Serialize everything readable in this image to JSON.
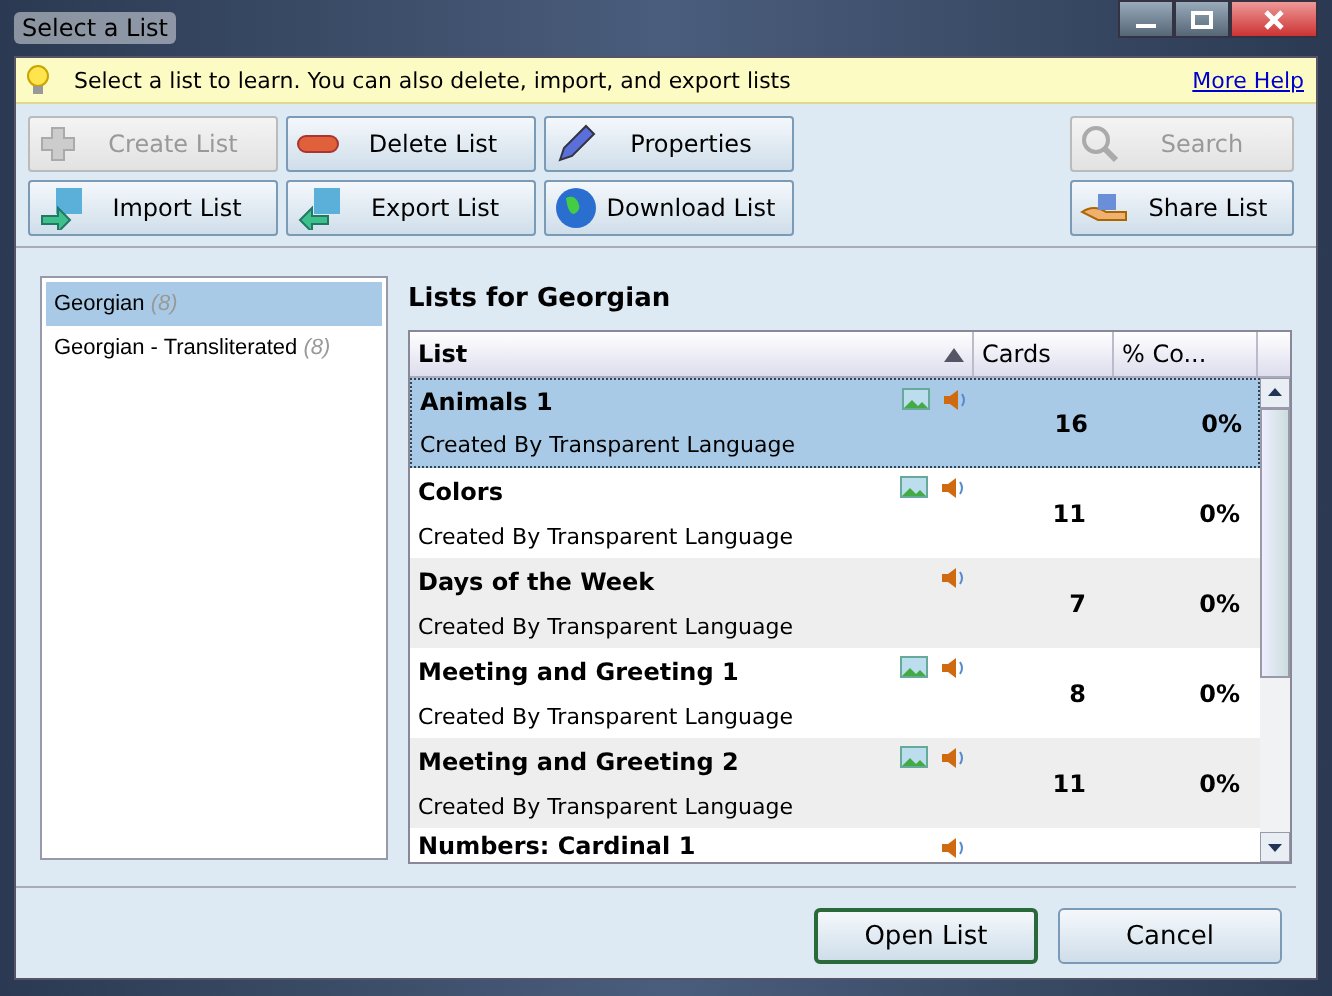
{
  "window": {
    "title": "Select a List"
  },
  "info_bar": {
    "message": "Select a list to learn. You can also delete, import, and export lists",
    "link": "More Help"
  },
  "toolbar": {
    "left": [
      {
        "label": "Create List",
        "kind": "create",
        "disabled": true
      },
      {
        "label": "Delete List",
        "kind": "delete",
        "disabled": false
      },
      {
        "label": "Properties",
        "kind": "edit",
        "disabled": false
      },
      {
        "label": "Import List",
        "kind": "import",
        "disabled": false
      },
      {
        "label": "Export List",
        "kind": "export",
        "disabled": false
      },
      {
        "label": "Download List",
        "kind": "download",
        "disabled": false
      }
    ],
    "right": [
      {
        "label": "Search",
        "kind": "search",
        "disabled": true
      },
      {
        "label": "Share List",
        "kind": "share",
        "disabled": false
      }
    ]
  },
  "languages": [
    {
      "name": "Georgian",
      "count": "(8)",
      "selected": true
    },
    {
      "name": "Georgian - Transliterated",
      "count": "(8)",
      "selected": false
    }
  ],
  "lists_heading": "Lists for Georgian",
  "table": {
    "columns": [
      "List",
      "Cards",
      "% Co..."
    ],
    "sort_ascending": true,
    "rows": [
      {
        "title": "Animals 1",
        "author": "Created By Transparent Language",
        "cards": "16",
        "complete": "0%",
        "has_image": true,
        "has_sound": true,
        "selected": true
      },
      {
        "title": "Colors",
        "author": "Created By Transparent Language",
        "cards": "11",
        "complete": "0%",
        "has_image": true,
        "has_sound": true,
        "selected": false
      },
      {
        "title": "Days of the Week",
        "author": "Created By Transparent Language",
        "cards": "7",
        "complete": "0%",
        "has_image": false,
        "has_sound": true,
        "selected": false
      },
      {
        "title": "Meeting and Greeting 1",
        "author": "Created By Transparent Language",
        "cards": "8",
        "complete": "0%",
        "has_image": true,
        "has_sound": true,
        "selected": false
      },
      {
        "title": "Meeting and Greeting 2",
        "author": "Created By Transparent Language",
        "cards": "11",
        "complete": "0%",
        "has_image": true,
        "has_sound": true,
        "selected": false
      },
      {
        "title": "Numbers: Cardinal 1",
        "has_image": false,
        "has_sound": true,
        "selected": false
      }
    ]
  },
  "footer": [
    {
      "label": "Open List",
      "default": true
    },
    {
      "label": "Cancel",
      "default": false
    }
  ]
}
